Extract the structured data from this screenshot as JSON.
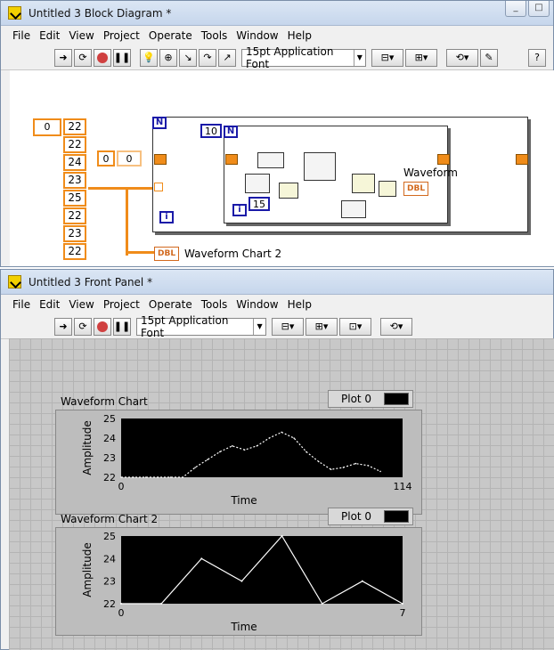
{
  "block_diagram": {
    "title": "Untitled 3 Block Diagram *",
    "menus": [
      "File",
      "Edit",
      "View",
      "Project",
      "Operate",
      "Tools",
      "Window",
      "Help"
    ],
    "font": "15pt Application Font",
    "index_value": "0",
    "array_values": [
      "22",
      "22",
      "24",
      "23",
      "25",
      "22",
      "23",
      "22"
    ],
    "numeric_constant": "0",
    "numeric_index": "0",
    "n_constant_outer": "N",
    "n_constant_inner": "N",
    "ten_constant": "10",
    "fifteen_constant": "15",
    "loop_index_outer": "i",
    "loop_index_inner": "i",
    "dbl_label": "DBL",
    "indicator_label_1": "Waveform",
    "indicator_label_2": "Waveform Chart 2"
  },
  "front_panel": {
    "title": "Untitled 3 Front Panel *",
    "menus": [
      "File",
      "Edit",
      "View",
      "Project",
      "Operate",
      "Tools",
      "Window",
      "Help"
    ],
    "font": "15pt Application Font",
    "charts": [
      {
        "title": "Waveform Chart",
        "legend": "Plot 0",
        "ylabel": "Amplitude",
        "xlabel": "Time",
        "y_ticks": [
          "25",
          "24",
          "23",
          "22"
        ],
        "x_min": "0",
        "x_max": "114"
      },
      {
        "title": "Waveform Chart 2",
        "legend": "Plot 0",
        "ylabel": "Amplitude",
        "xlabel": "Time",
        "y_ticks": [
          "25",
          "24",
          "23",
          "22"
        ],
        "x_min": "0",
        "x_max": "7"
      }
    ]
  },
  "chart_data": [
    {
      "type": "line",
      "title": "Waveform Chart",
      "xlabel": "Time",
      "ylabel": "Amplitude",
      "xlim": [
        0,
        114
      ],
      "ylim": [
        22,
        25
      ],
      "series": [
        {
          "name": "Plot 0",
          "x": [
            0,
            5,
            10,
            15,
            20,
            25,
            30,
            35,
            40,
            45,
            50,
            55,
            60,
            65,
            70,
            75,
            80,
            85,
            90,
            95,
            100,
            105
          ],
          "y": [
            22,
            22,
            22,
            22,
            22,
            22,
            22.5,
            22.9,
            23.3,
            23.6,
            23.4,
            23.6,
            24.0,
            24.3,
            24.0,
            23.3,
            22.8,
            22.4,
            22.5,
            22.7,
            22.6,
            22.3
          ]
        }
      ]
    },
    {
      "type": "line",
      "title": "Waveform Chart 2",
      "xlabel": "Time",
      "ylabel": "Amplitude",
      "xlim": [
        0,
        7
      ],
      "ylim": [
        22,
        25
      ],
      "series": [
        {
          "name": "Plot 0",
          "x": [
            0,
            1,
            2,
            3,
            4,
            5,
            6,
            7
          ],
          "y": [
            22,
            22,
            24,
            23,
            25,
            22,
            23,
            22
          ]
        }
      ]
    }
  ]
}
